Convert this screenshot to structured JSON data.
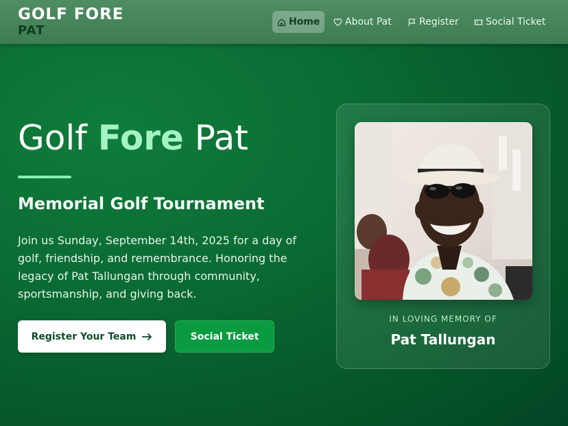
{
  "brand": {
    "line1": "GOLF FORE",
    "line2": "PAT"
  },
  "nav": {
    "items": [
      {
        "label": "Home",
        "icon": "home-icon",
        "active": true
      },
      {
        "label": "About Pat",
        "icon": "heart-icon",
        "active": false
      },
      {
        "label": "Register",
        "icon": "flag-icon",
        "active": false
      },
      {
        "label": "Social Ticket",
        "icon": "ticket-icon",
        "active": false
      }
    ]
  },
  "hero": {
    "title_start": "Golf ",
    "title_accent": "Fore",
    "title_end": " Pat",
    "subtitle": "Memorial Golf Tournament",
    "description": "Join us Sunday, September 14th, 2025 for a day of golf, friendship, and remembrance. Honoring the legacy of Pat Tallungan through community, sportsmanship, and giving back.",
    "primary_button": "Register Your Team",
    "primary_button_icon": "arrow-right-icon",
    "secondary_button": "Social Ticket"
  },
  "memorial": {
    "label": "IN LOVING MEMORY OF",
    "name": "Pat Tallungan"
  },
  "colors": {
    "nav_bg": "#3e7c52",
    "hero_bg": "#0a6a33",
    "accent": "#a5f3c3",
    "divider": "#86efac",
    "secondary_button": "#0a9b40"
  }
}
